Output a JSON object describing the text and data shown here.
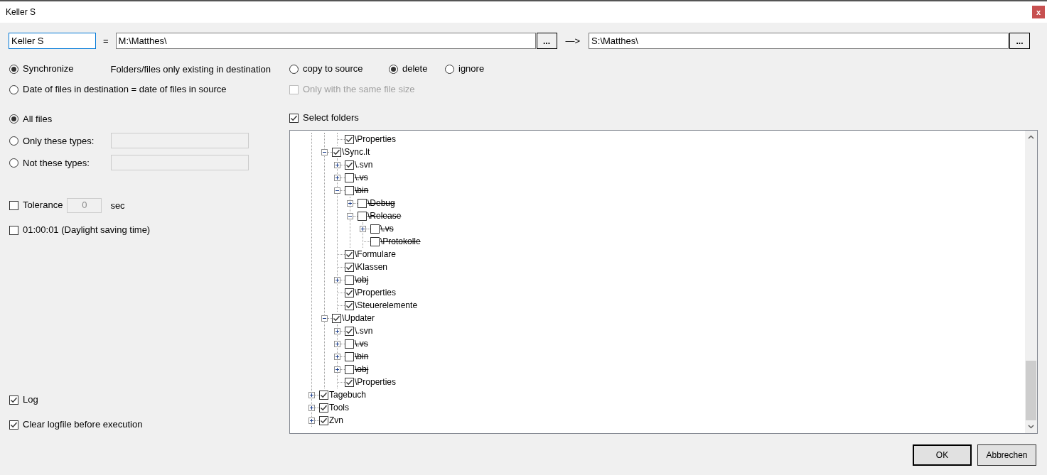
{
  "window": {
    "title": "Keller S",
    "close": "x"
  },
  "name_field": {
    "value": "Keller S"
  },
  "equals": "=",
  "source": {
    "value": "M:\\Matthes\\",
    "browse": "..."
  },
  "arrow": "—>",
  "destination": {
    "value": "S:\\Matthes\\",
    "browse": "..."
  },
  "modes": [
    {
      "label": "Synchronize",
      "selected": true
    },
    {
      "label": "Date of files in destination = date of files in source",
      "selected": false
    }
  ],
  "dest_only": {
    "label": "Folders/files only existing in destination",
    "options": [
      {
        "label": "copy to source",
        "selected": false
      },
      {
        "label": "delete",
        "selected": true
      },
      {
        "label": "ignore",
        "selected": false
      }
    ]
  },
  "same_size": {
    "label": "Only with the same file size",
    "checked": false,
    "disabled": true
  },
  "file_filter": [
    {
      "label": "All files",
      "selected": true,
      "kind": "plain"
    },
    {
      "label": "Only these types:",
      "selected": false,
      "kind": "field"
    },
    {
      "label": "Not these types:",
      "selected": false,
      "kind": "field"
    }
  ],
  "tolerance": {
    "label": "Tolerance",
    "checked": false,
    "value": "0",
    "unit": "sec"
  },
  "daylight": {
    "label": "01:00:01 (Daylight saving time)",
    "checked": false
  },
  "select_folders": {
    "label": "Select folders",
    "checked": true
  },
  "tree": {
    "items": [
      {
        "children": [
          {
            "children": [
              {
                "label": "\\Properties",
                "checked": true
              }
            ]
          },
          {
            "label": "\\Sync.lt",
            "checked": true,
            "expanded": true,
            "children": [
              {
                "label": "\\.svn",
                "checked": true,
                "expanded": false
              },
              {
                "label": "\\.vs",
                "checked": false,
                "expanded": false
              },
              {
                "label": "\\bin",
                "checked": false,
                "expanded": true,
                "children": [
                  {
                    "label": "\\Debug",
                    "checked": false,
                    "expanded": false
                  },
                  {
                    "label": "\\Release",
                    "checked": false,
                    "expanded": true,
                    "children": [
                      {
                        "label": "\\.vs",
                        "checked": false,
                        "expanded": false
                      },
                      {
                        "label": "\\Protokolle",
                        "checked": false
                      }
                    ]
                  }
                ]
              },
              {
                "label": "\\Formulare",
                "checked": true
              },
              {
                "label": "\\Klassen",
                "checked": true
              },
              {
                "label": "\\obj",
                "checked": false,
                "expanded": false
              },
              {
                "label": "\\Properties",
                "checked": true
              },
              {
                "label": "\\Steuerelemente",
                "checked": true
              }
            ]
          },
          {
            "label": "\\Updater",
            "checked": true,
            "expanded": true,
            "children": [
              {
                "label": "\\.svn",
                "checked": true,
                "expanded": false
              },
              {
                "label": "\\.vs",
                "checked": false,
                "expanded": false
              },
              {
                "label": "\\bin",
                "checked": false,
                "expanded": false
              },
              {
                "label": "\\obj",
                "checked": false,
                "expanded": false
              },
              {
                "label": "\\Properties",
                "checked": true
              }
            ]
          }
        ]
      },
      {
        "label": "Tagebuch",
        "checked": true,
        "expanded": false
      },
      {
        "label": "Tools",
        "checked": true,
        "expanded": false
      },
      {
        "label": "Zvn",
        "checked": true,
        "expanded": false
      }
    ]
  },
  "log": {
    "label": "Log",
    "checked": true
  },
  "clear_log": {
    "label": "Clear logfile before execution",
    "checked": true
  },
  "buttons": [
    {
      "label": "OK",
      "default": true
    },
    {
      "label": "Abbrechen",
      "default": false
    }
  ]
}
